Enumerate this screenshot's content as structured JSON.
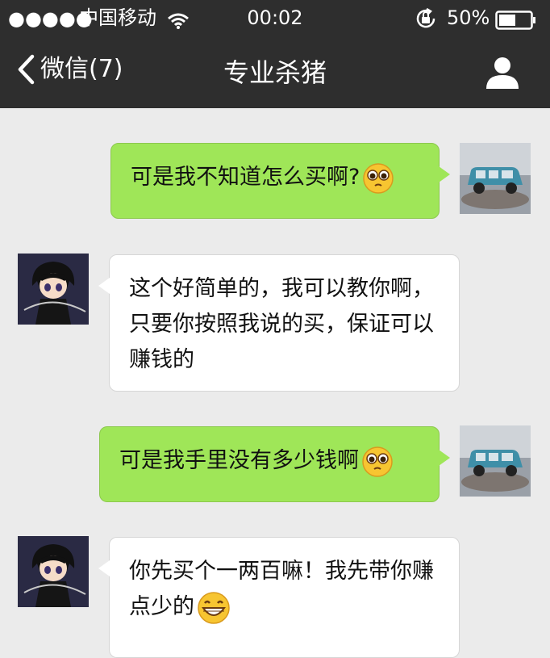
{
  "status_bar": {
    "signal": "●●●●●",
    "carrier": "中国移动",
    "time": "00:02",
    "battery": "50%",
    "icons": [
      "wifi-icon",
      "rotation-lock-icon",
      "battery-icon"
    ]
  },
  "nav": {
    "back_label": "微信(7)",
    "title": "专业杀猪",
    "icons": [
      "chevron-left-icon",
      "person-icon"
    ]
  },
  "messages": [
    {
      "side": "sent",
      "text": "可是我不知道怎么买啊?",
      "emoji": "pleading-face-emoji"
    },
    {
      "side": "received",
      "text": "这个好简单的，我可以教你啊，只要你按照我说的买，保证可以赚钱的"
    },
    {
      "side": "sent",
      "text": "可是我手里没有多少钱啊",
      "emoji": "pleading-face-emoji"
    },
    {
      "side": "received",
      "text": "你先买个一两百嘛！我先带你赚点少的",
      "emoji": "grinning-face-emoji"
    }
  ],
  "colors": {
    "header": "#2e2e2e",
    "chat_background": "#ebebeb",
    "sent_bubble": "#9fe658",
    "received_bubble": "#ffffff"
  }
}
